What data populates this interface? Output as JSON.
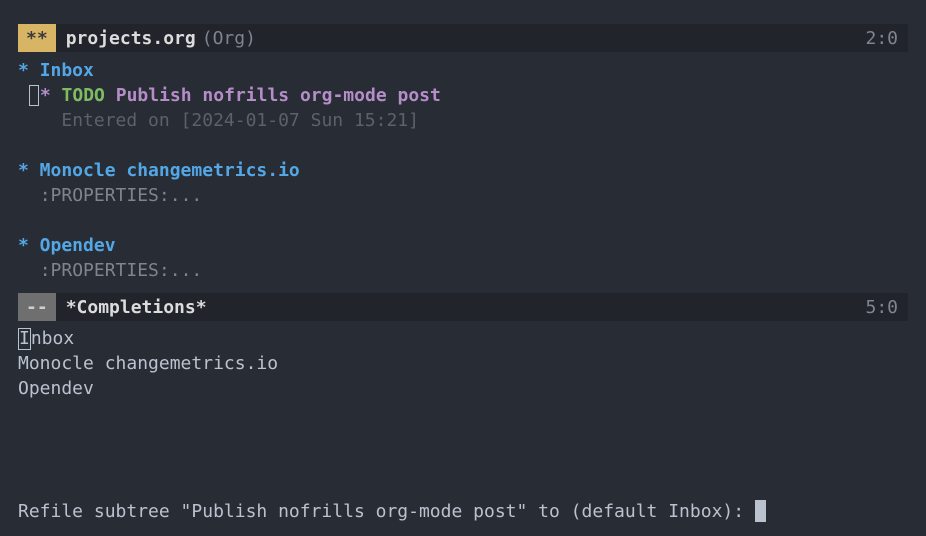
{
  "top_modeline": {
    "status": "**",
    "buffer_name": "projects.org",
    "mode": "(Org)",
    "position": "2:0"
  },
  "org": {
    "h1_inbox": "* Inbox",
    "todo_star": "*",
    "todo_kw": "TODO",
    "todo_title": "Publish nofrills org-mode post",
    "entered": "Entered on [2024-01-07 Sun 15:21]",
    "h1_monocle": "* Monocle changemetrics.io",
    "drawer1": ":PROPERTIES:...",
    "h1_opendev": "* Opendev",
    "drawer2": ":PROPERTIES:..."
  },
  "comp_modeline": {
    "status": "--",
    "buffer_name": "*Completions*",
    "position": "5:0"
  },
  "completions": {
    "first_char": "I",
    "first_rest": "nbox",
    "item2": "Monocle changemetrics.io",
    "item3": "Opendev"
  },
  "minibuffer": {
    "prompt": "Refile subtree \"Publish nofrills org-mode post\" to (default Inbox): "
  }
}
